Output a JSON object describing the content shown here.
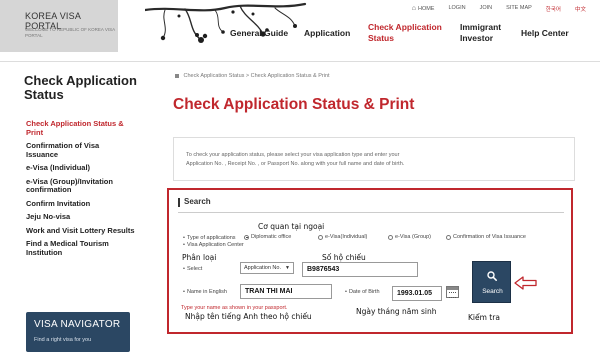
{
  "header": {
    "logo_title": "KOREA VISA PORTAL",
    "logo_sub": "WELCOME TO REPUBLIC OF KOREA VISA PORTAL",
    "util_nav": [
      {
        "label": "HOME"
      },
      {
        "label": "LOGIN"
      },
      {
        "label": "JOIN"
      },
      {
        "label": "SITE MAP"
      },
      {
        "label": "한국어"
      },
      {
        "label": "中文"
      }
    ],
    "gnb": [
      {
        "line1": "General Guide",
        "line2": ""
      },
      {
        "line1": "Application",
        "line2": ""
      },
      {
        "line1": "Check Application",
        "line2": "Status"
      },
      {
        "line1": "Immigrant",
        "line2": "Investor"
      },
      {
        "line1": "Help Center",
        "line2": ""
      }
    ]
  },
  "sidebar": {
    "title_line1": "Check Application",
    "title_line2": "Status",
    "items": [
      {
        "label": "Check Application Status & Print"
      },
      {
        "label": "Confirmation of Visa Issuance"
      },
      {
        "label": "e-Visa (Individual)"
      },
      {
        "label": "e-Visa (Group)/Invitation confirmation"
      },
      {
        "label": "Confirm Invitation"
      },
      {
        "label": "Jeju No-visa"
      },
      {
        "label": "Work and Visit Lottery Results"
      },
      {
        "label": "Find a Medical Tourism Institution"
      }
    ],
    "banner_title": "VISA NAVIGATOR",
    "banner_sub": "Find a right visa for you"
  },
  "main": {
    "breadcrumb": [
      "Check Application Status",
      "Check Application Status & Print"
    ],
    "page_title": "Check Application Status & Print",
    "intro_line1": "To check your application status, please select your visa application type and enter your",
    "intro_line2": "Application No. , Receipt No. , or Passport No. along with your full name and date of birth."
  },
  "search": {
    "heading": "Search",
    "type_label": "Type of applications",
    "type_label2": "Visa Application Center",
    "type_options": [
      {
        "label": "Diplomatic office",
        "checked": true
      },
      {
        "label": "e-Visa(Individual)",
        "checked": false
      },
      {
        "label": "e-Visa (Group)",
        "checked": false
      },
      {
        "label": "Confirmation of Visa Issuance",
        "checked": false
      }
    ],
    "select_label": "Select",
    "select_value": "Application No.",
    "select_number_value": "B9876543",
    "name_label": "Name in English",
    "name_value": "TRAN THI MAI",
    "dob_label": "Date of Birth",
    "dob_value": "1993.01.05",
    "name_hint": "Type your name as shown in your passport.",
    "button_label": "Search"
  },
  "annotations": {
    "type": "Cơ quan tại ngoại",
    "category": "Phân loại",
    "passport": "Số hộ chiếu",
    "name": "Nhập tên tiếng Anh theo hộ chiếu",
    "dob": "Ngày tháng năm sinh",
    "search": "Kiểm tra"
  },
  "colors": {
    "accent_red": "#c0272d",
    "navy": "#2b4763"
  },
  "icons": {
    "home": "home-icon",
    "search": "magnifier-icon",
    "calendar": "calendar-icon",
    "arrow": "left-arrow-icon"
  }
}
